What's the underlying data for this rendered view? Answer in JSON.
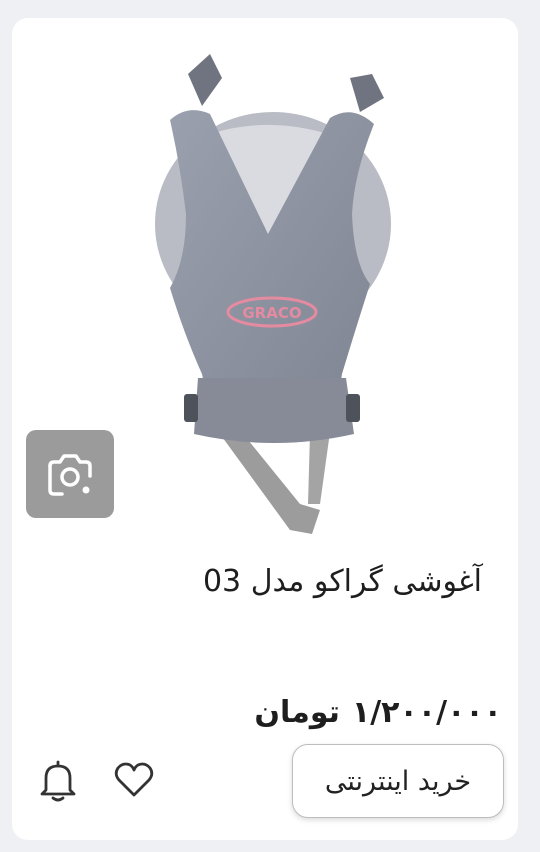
{
  "product": {
    "title": "آغوشی گراکو مدل 03",
    "price_value": "۱/۲۰۰/۰۰۰",
    "price_unit": "تومان",
    "brand_logo_text": "GRACO"
  },
  "actions": {
    "buy_label": "خرید اینترنتی"
  },
  "icons": {
    "visual_search": "camera-icon",
    "favorite": "heart-icon",
    "notify": "bell-icon"
  },
  "colors": {
    "carrier_fabric": "#8d929e",
    "logo_pink": "#e58ba1",
    "camera_bg": "#9b9b9b"
  }
}
